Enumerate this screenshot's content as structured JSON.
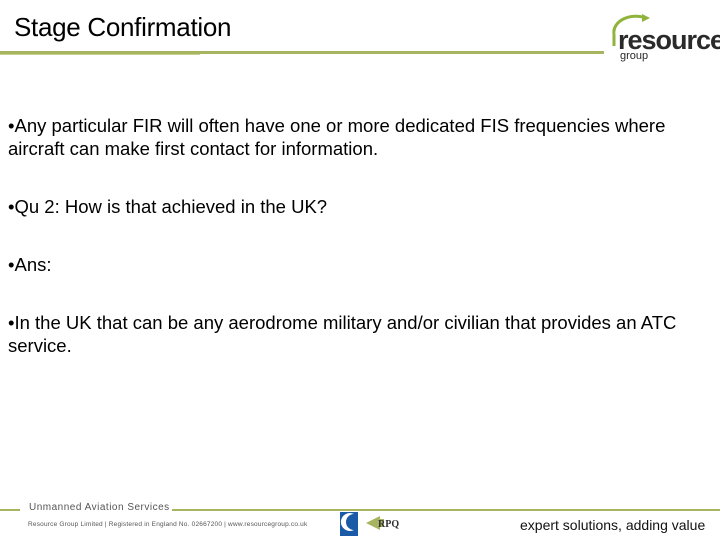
{
  "header": {
    "title": "Stage Confirmation",
    "logo": {
      "word": "resource",
      "sub": "group",
      "accent_color": "#8fb33b"
    }
  },
  "content": {
    "bullets": [
      "•Any particular FIR will often have one or more dedicated FIS frequencies where aircraft can make first contact for information.",
      "•Qu 2:  How is that achieved in the UK?",
      "•Ans:",
      "•In the UK that can be any aerodrome military and/or civilian that provides an ATC service."
    ]
  },
  "footer": {
    "service": "Unmanned Aviation Services",
    "registration": "Resource Group Limited | Registered in England No. 02667200 | www.resourcegroup.co.uk",
    "caa_logo": "caa-logo",
    "rpq_logo": "RPQ",
    "tagline": "expert solutions, adding value"
  },
  "colors": {
    "accent_line": "#a8b560"
  }
}
